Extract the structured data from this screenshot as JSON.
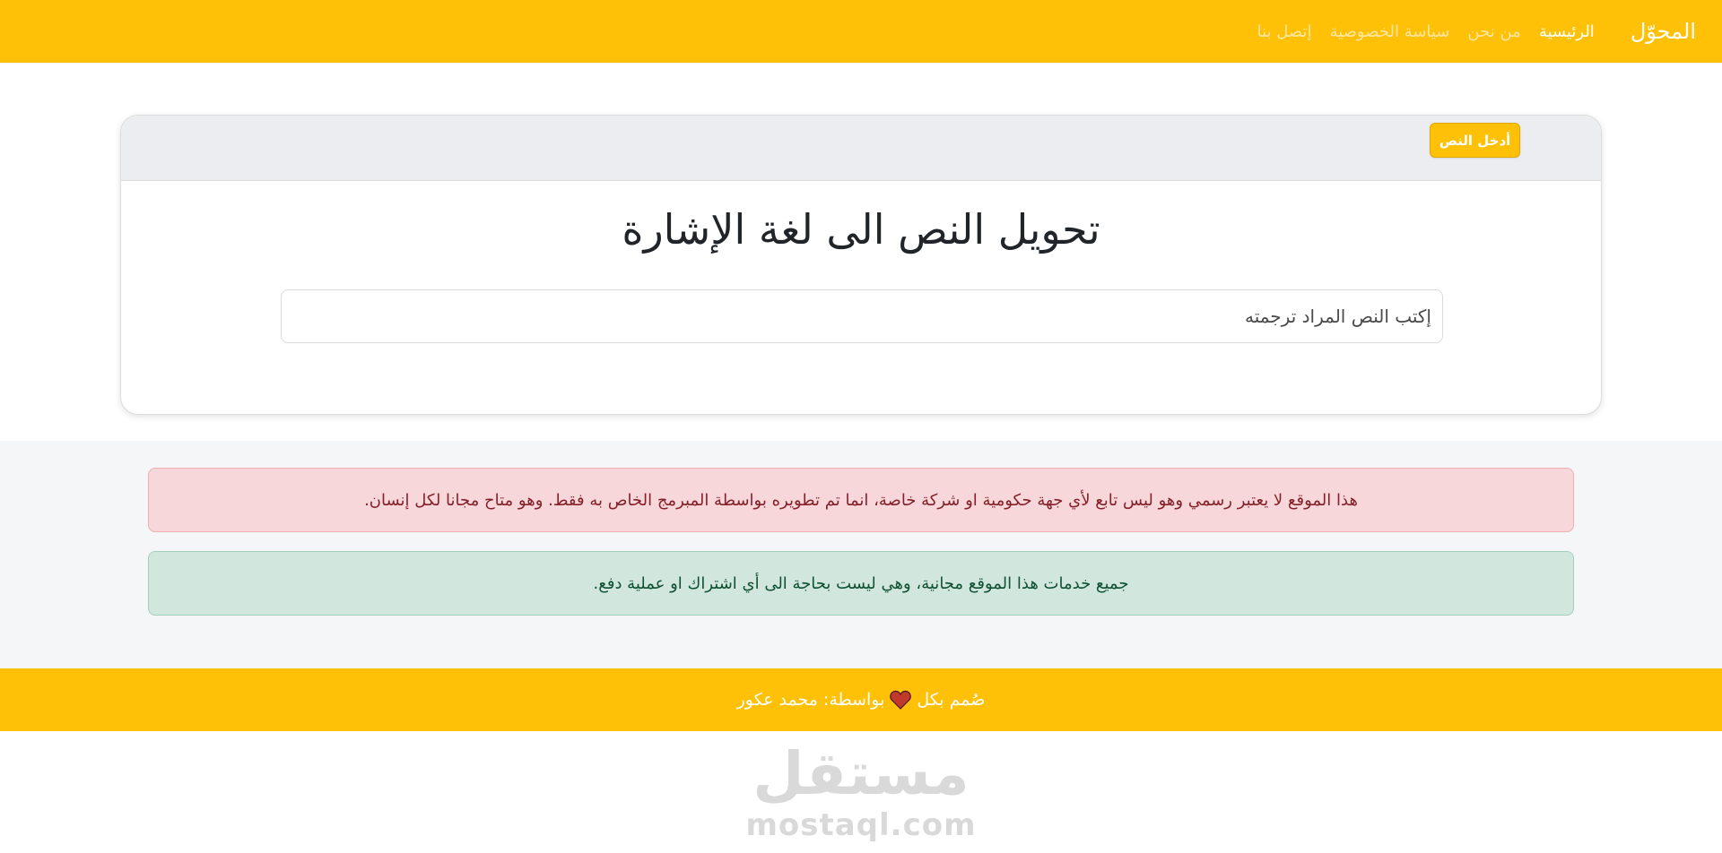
{
  "navbar": {
    "brand": "المحوّل",
    "links": [
      {
        "label": "الرئيسية",
        "active": true
      },
      {
        "label": "من نحن",
        "active": false
      },
      {
        "label": "سياسة الخصوصية",
        "active": false
      },
      {
        "label": "إتصل بنا",
        "active": false
      }
    ]
  },
  "card": {
    "header_button": "أدخل النص",
    "title": "تحويل النص الى لغة الإشارة",
    "input_placeholder": "إكتب النص المراد ترجمته"
  },
  "notices": {
    "danger": "هذا الموقع لا يعتبر رسمي وهو ليس تابع لأي جهة حكومية او شركة خاصة، انما تم تطويره بواسطة المبرمج الخاص به فقط. وهو متاح مجانا لكل إنسان.",
    "success": "جميع خدمات هذا الموقع مجانية، وهي ليست بحاجة الى أي اشتراك او عملية دفع."
  },
  "footer": {
    "prefix": "صُمم بكل",
    "icon": "heart-icon",
    "suffix": "بواسطة: محمد عكور"
  },
  "watermark": {
    "arabic": "مستقل",
    "latin": "mostaql.com"
  },
  "colors": {
    "primary": "#ffc107",
    "danger_bg": "#f8d7da",
    "success_bg": "#d1e7dd",
    "heart": "#c0392b"
  }
}
